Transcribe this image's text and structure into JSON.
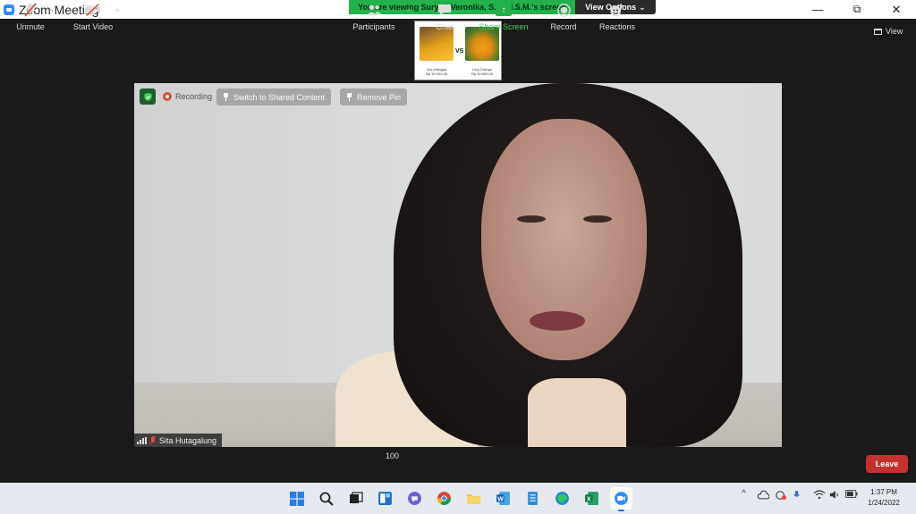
{
  "window": {
    "title": "Zoom Meeting",
    "controls": {
      "minimize": "—",
      "restore": "⧉",
      "close": "✕"
    }
  },
  "banner": {
    "viewing_text": "You are viewing Suryati Veronika, S.E.,M.S.M.'s screen",
    "view_options_label": "View Options",
    "view_options_caret": "⌄",
    "color": "#22b14c"
  },
  "shared_content": {
    "vs_label": "VS",
    "left_caption": "Jus Mangga\nRp 15.000,00",
    "right_caption": "Ling Orange\nRp 15.000,00"
  },
  "view_button": {
    "label": "View"
  },
  "meeting_controls": {
    "recording_label": "Recording",
    "switch_label": "Switch to Shared Content",
    "remove_pin_label": "Remove Pin"
  },
  "participant": {
    "name": "Sita Hutagalung"
  },
  "toolbar": {
    "unmute_label": "Unmute",
    "start_video_label": "Start Video",
    "participants_label": "Participants",
    "participants_count": "100",
    "chat_label": "Chat",
    "share_label": "Share Screen",
    "record_label": "Record",
    "reactions_label": "Reactions",
    "leave_label": "Leave",
    "caret": "^"
  },
  "taskbar": {
    "time": "1:37 PM",
    "date": "1/24/2022",
    "tray_caret": "^"
  },
  "colors": {
    "leave": "#c4302b",
    "share": "#22b14c",
    "muted": "#e24a3b"
  }
}
